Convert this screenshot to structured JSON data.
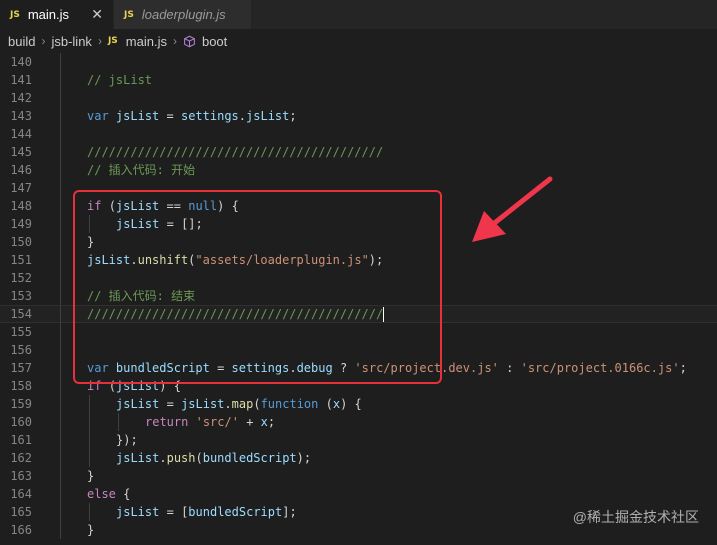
{
  "tabs": [
    {
      "badge": "JS",
      "label": "main.js",
      "close": "✕"
    },
    {
      "badge": "JS",
      "label": "loaderplugin.js"
    }
  ],
  "breadcrumb": {
    "folder1": "build",
    "folder2": "jsb-link",
    "badge": "JS",
    "file": "main.js",
    "symbol": "boot",
    "separator": "›"
  },
  "editor": {
    "lines": [
      {
        "n": "140",
        "text": ""
      },
      {
        "n": "141",
        "text": "// jsList"
      },
      {
        "n": "142",
        "text": ""
      },
      {
        "n": "143",
        "text": "var jsList = settings.jsList;"
      },
      {
        "n": "144",
        "text": ""
      },
      {
        "n": "145",
        "text": "/////////////////////////////////////////"
      },
      {
        "n": "146",
        "text": "// 插入代码: 开始"
      },
      {
        "n": "147",
        "text": ""
      },
      {
        "n": "148",
        "text": "if (jsList == null) {"
      },
      {
        "n": "149",
        "text": "    jsList = [];"
      },
      {
        "n": "150",
        "text": "}"
      },
      {
        "n": "151",
        "text": "jsList.unshift(\"assets/loaderplugin.js\");"
      },
      {
        "n": "152",
        "text": ""
      },
      {
        "n": "153",
        "text": "// 插入代码: 结束"
      },
      {
        "n": "154",
        "text": "/////////////////////////////////////////"
      },
      {
        "n": "155",
        "text": ""
      },
      {
        "n": "156",
        "text": ""
      },
      {
        "n": "157",
        "text": "var bundledScript = settings.debug ? 'src/project.dev.js' : 'src/project.0166c.js';"
      },
      {
        "n": "158",
        "text": "if (jsList) {"
      },
      {
        "n": "159",
        "text": "    jsList = jsList.map(function (x) {"
      },
      {
        "n": "160",
        "text": "        return 'src/' + x;"
      },
      {
        "n": "161",
        "text": "    });"
      },
      {
        "n": "162",
        "text": "    jsList.push(bundledScript);"
      },
      {
        "n": "163",
        "text": "}"
      },
      {
        "n": "164",
        "text": "else {"
      },
      {
        "n": "165",
        "text": "    jsList = [bundledScript];"
      },
      {
        "n": "166",
        "text": "}"
      }
    ]
  },
  "watermark": "@稀土掘金技术社区",
  "colors": {
    "highlight_box": "#e8303a",
    "arrow": "#f0364a",
    "js_badge": "#e8d44d"
  }
}
